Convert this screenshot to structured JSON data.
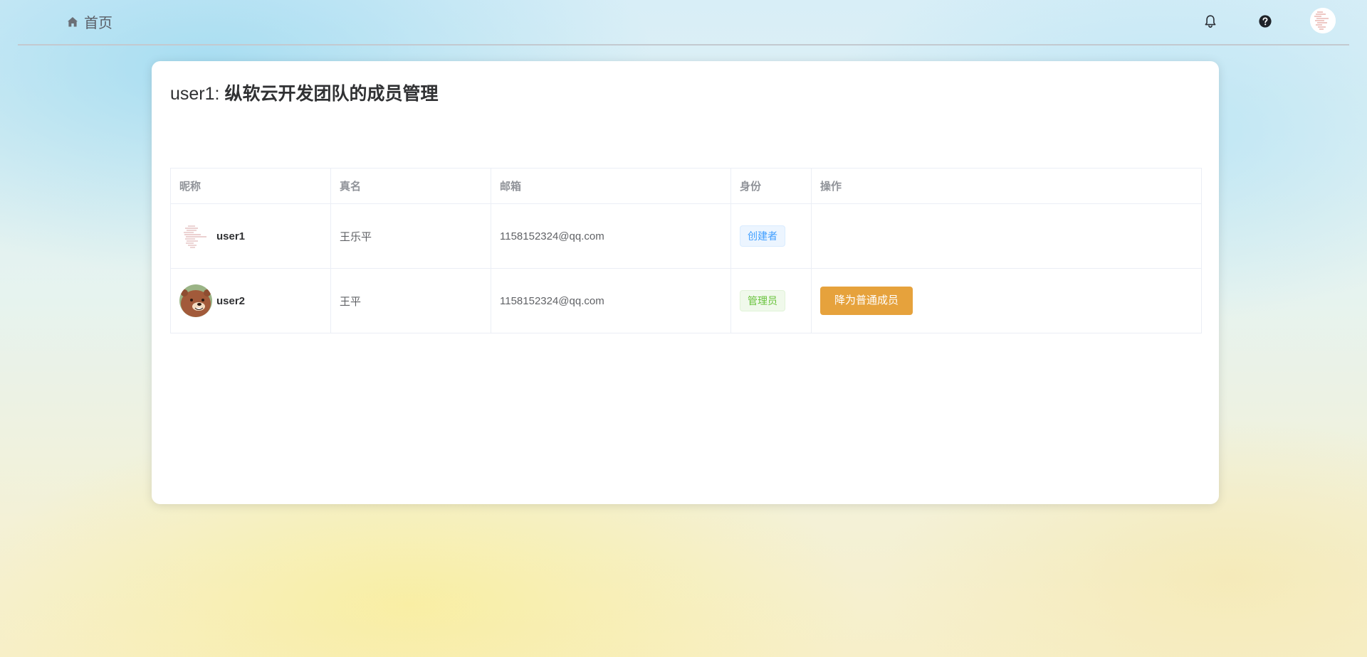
{
  "nav": {
    "home_label": "首页",
    "icons": [
      "home-icon",
      "bell-icon",
      "help-icon",
      "avatar"
    ]
  },
  "page": {
    "owner": "user1:",
    "team_title": "纵软云开发团队的成员管理"
  },
  "table": {
    "headers": [
      "昵称",
      "真名",
      "邮箱",
      "身份",
      "操作"
    ],
    "rows": [
      {
        "nickname": "user1",
        "real_name": "王乐平",
        "email": "1158152324@qq.com",
        "role": "创建者",
        "role_color": "#409eff",
        "action": ""
      },
      {
        "nickname": "user2",
        "real_name": "王平",
        "email": "1158152324@qq.com",
        "role": "管理员",
        "role_color": "#67c23a",
        "action": "降为普通成员"
      }
    ]
  },
  "colors": {
    "primary": "#409eff",
    "success": "#67c23a",
    "warning": "#e6a23c"
  }
}
